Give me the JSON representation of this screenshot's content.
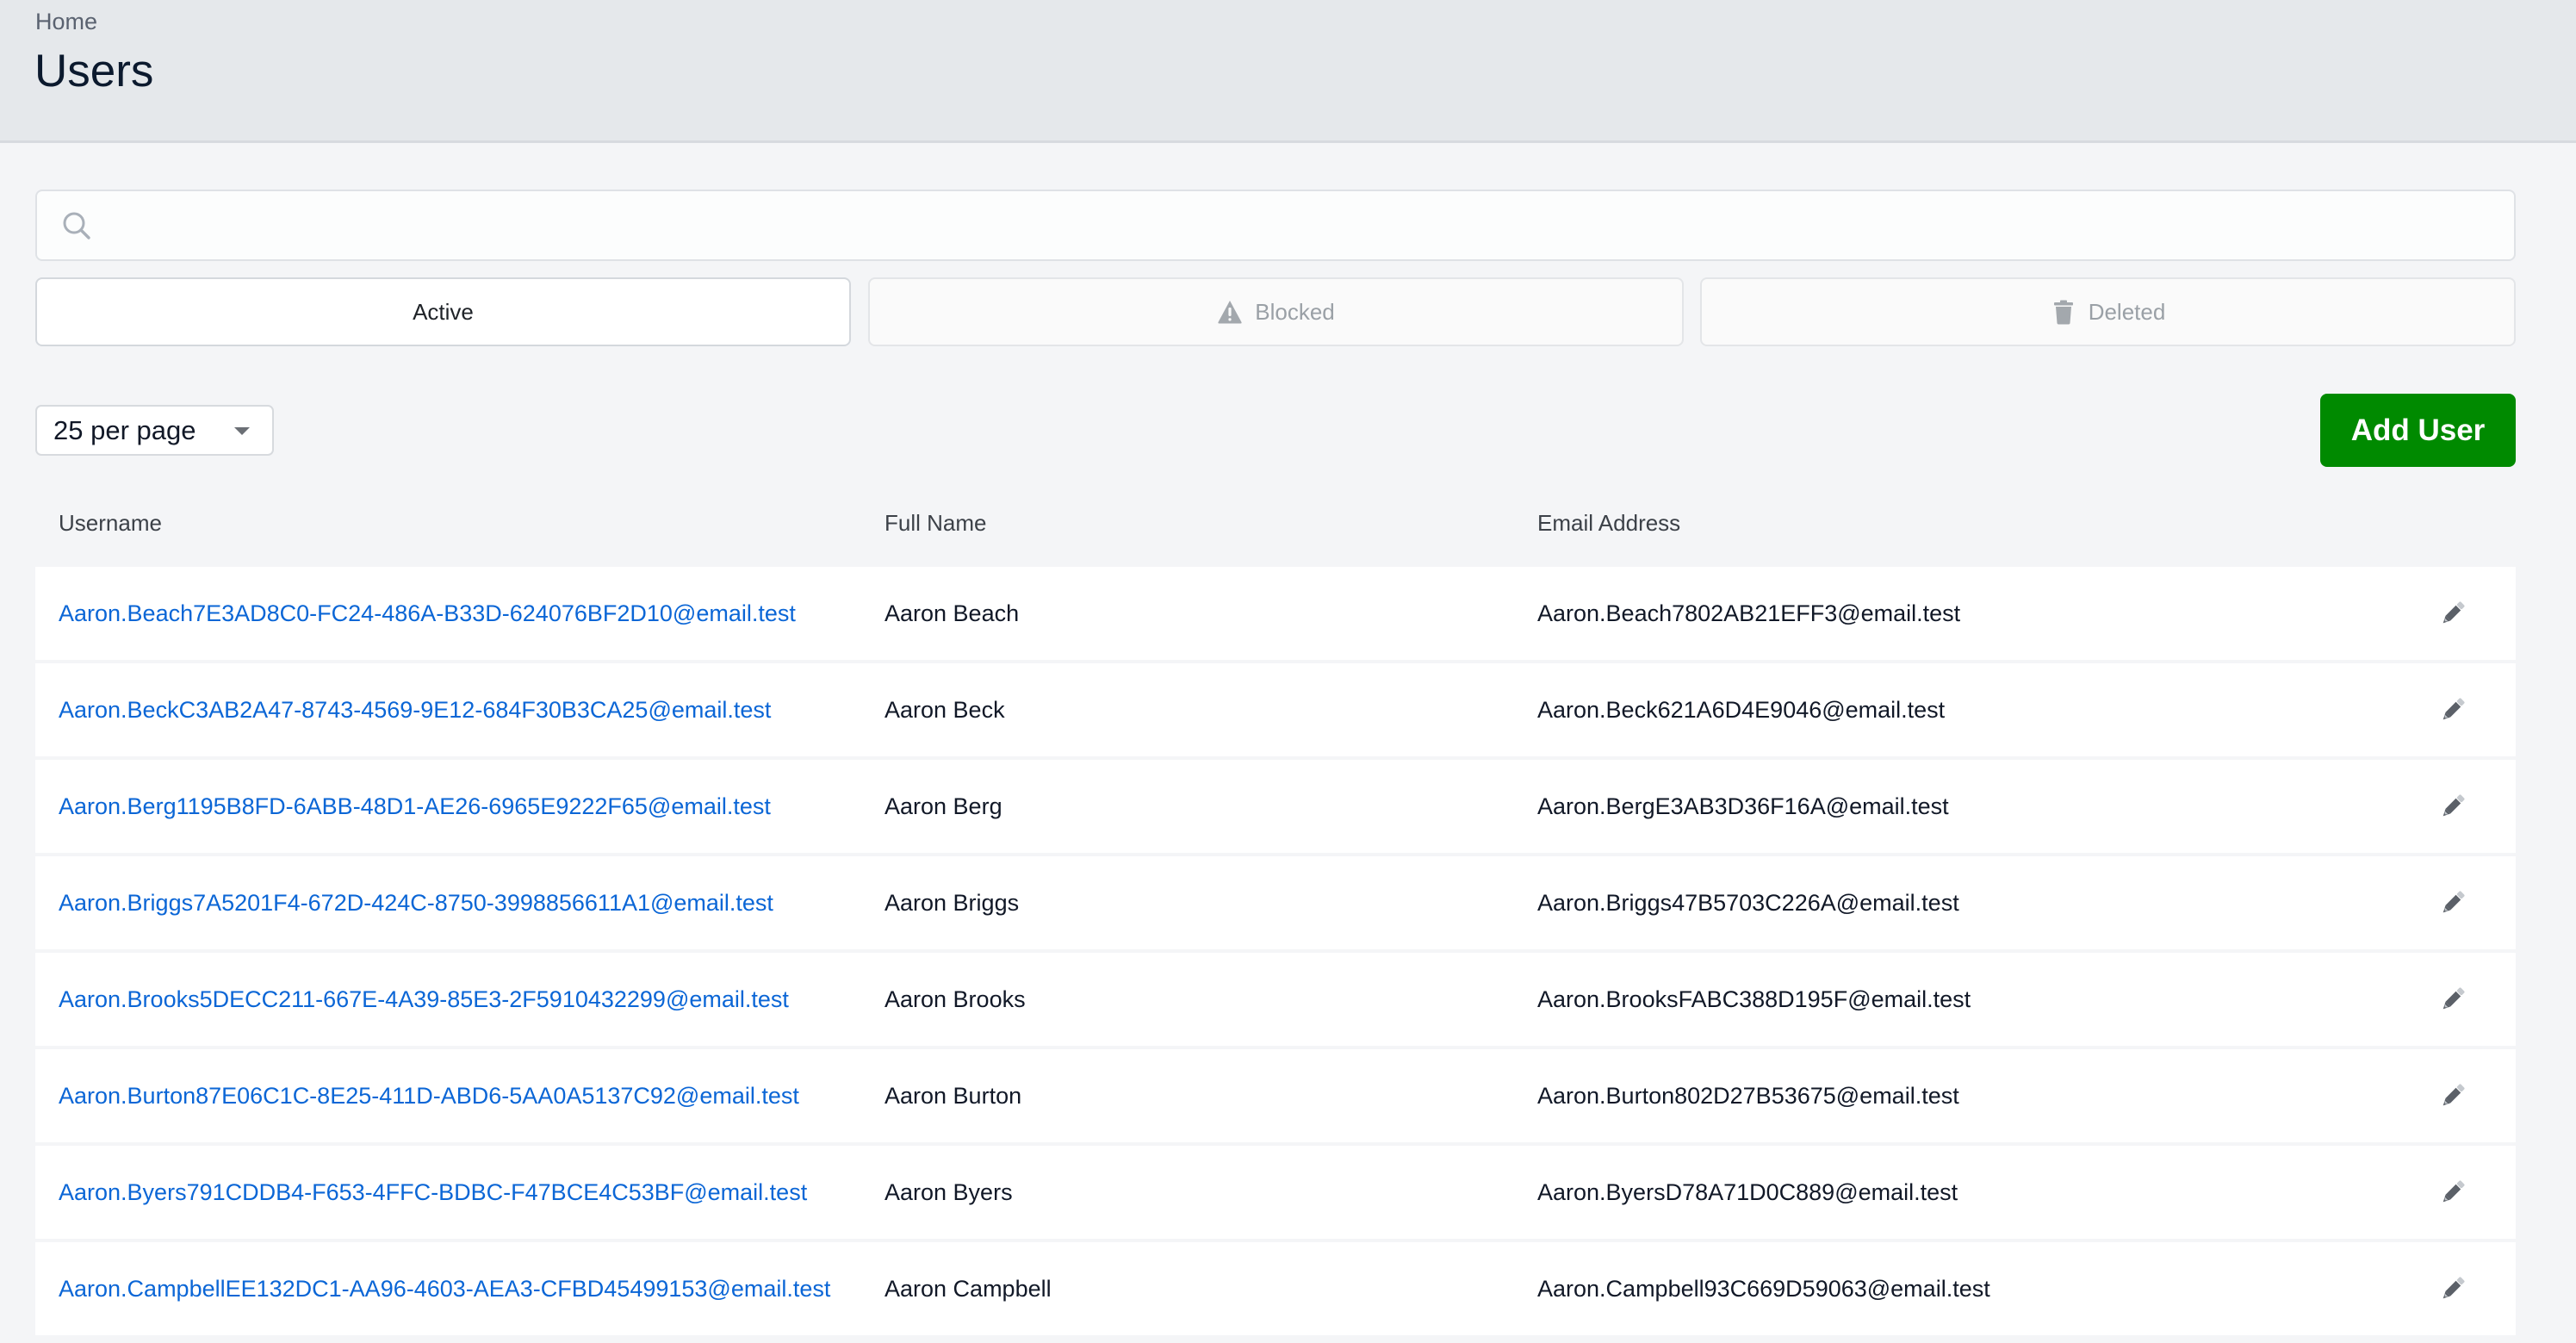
{
  "header": {
    "breadcrumb": "Home",
    "title": "Users"
  },
  "search": {
    "icon": "search-icon",
    "value": "",
    "placeholder": ""
  },
  "tabs": [
    {
      "label": "Active",
      "icon": null,
      "selected": true
    },
    {
      "label": "Blocked",
      "icon": "warning-triangle-icon",
      "selected": false
    },
    {
      "label": "Deleted",
      "icon": "trash-icon",
      "selected": false
    }
  ],
  "toolbar": {
    "per_page": {
      "selected": "25 per page",
      "icon": "caret-down-icon"
    },
    "add_user_label": "Add User"
  },
  "colors": {
    "accent_green": "#008a00",
    "link_blue": "#0b66d6",
    "header_bg": "#e5e8eb",
    "page_bg": "#f4f5f7"
  },
  "table": {
    "columns": [
      "Username",
      "Full Name",
      "Email Address"
    ],
    "row_action_icon": "pencil-edit-icon",
    "rows": [
      {
        "username": "Aaron.Beach7E3AD8C0-FC24-486A-B33D-624076BF2D10@email.test",
        "full_name": "Aaron Beach",
        "email": "Aaron.Beach7802AB21EFF3@email.test"
      },
      {
        "username": "Aaron.BeckC3AB2A47-8743-4569-9E12-684F30B3CA25@email.test",
        "full_name": "Aaron Beck",
        "email": "Aaron.Beck621A6D4E9046@email.test"
      },
      {
        "username": "Aaron.Berg1195B8FD-6ABB-48D1-AE26-6965E9222F65@email.test",
        "full_name": "Aaron Berg",
        "email": "Aaron.BergE3AB3D36F16A@email.test"
      },
      {
        "username": "Aaron.Briggs7A5201F4-672D-424C-8750-3998856611A1@email.test",
        "full_name": "Aaron Briggs",
        "email": "Aaron.Briggs47B5703C226A@email.test"
      },
      {
        "username": "Aaron.Brooks5DECC211-667E-4A39-85E3-2F5910432299@email.test",
        "full_name": "Aaron Brooks",
        "email": "Aaron.BrooksFABC388D195F@email.test"
      },
      {
        "username": "Aaron.Burton87E06C1C-8E25-411D-ABD6-5AA0A5137C92@email.test",
        "full_name": "Aaron Burton",
        "email": "Aaron.Burton802D27B53675@email.test"
      },
      {
        "username": "Aaron.Byers791CDDB4-F653-4FFC-BDBC-F47BCE4C53BF@email.test",
        "full_name": "Aaron Byers",
        "email": "Aaron.ByersD78A71D0C889@email.test"
      },
      {
        "username": "Aaron.CampbellEE132DC1-AA96-4603-AEA3-CFBD45499153@email.test",
        "full_name": "Aaron Campbell",
        "email": "Aaron.Campbell93C669D59063@email.test"
      }
    ]
  }
}
